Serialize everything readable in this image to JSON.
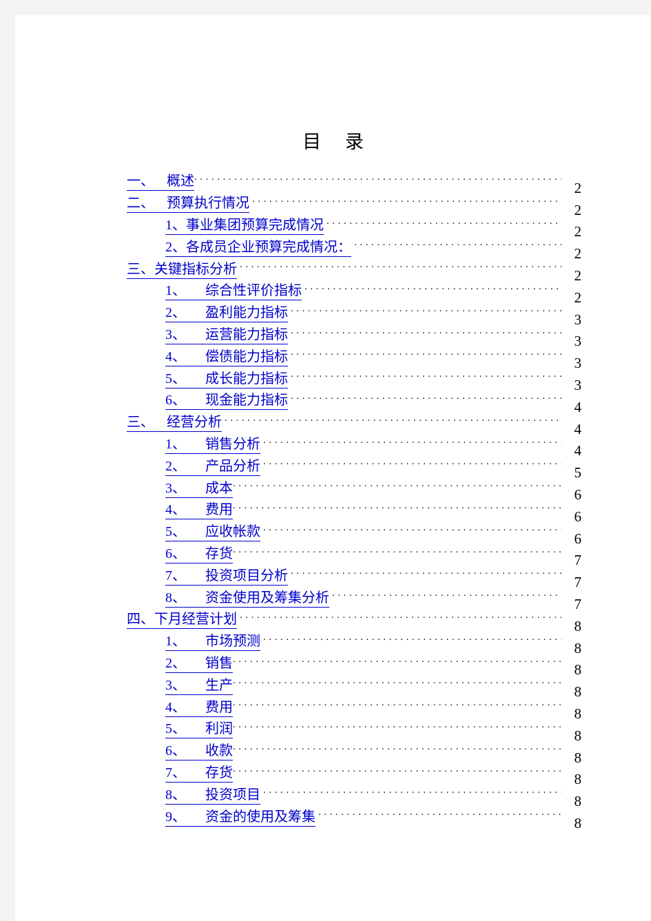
{
  "document": {
    "title": "目  录",
    "link_color": "#0000cc",
    "page_number_color": "#000000"
  },
  "toc": {
    "entries": [
      {
        "number": "一、",
        "label": "概述",
        "page": "2",
        "level": 1,
        "gap": "wide",
        "tight_leader": true
      },
      {
        "number": "二、",
        "label": "预算执行情况",
        "page": "2",
        "level": 1,
        "gap": "wide",
        "tight_leader": false
      },
      {
        "number": "1、",
        "label": "事业集团预算完成情况",
        "page": "2",
        "level": 2,
        "gap": "narrow",
        "tight_leader": false
      },
      {
        "number": "2、",
        "label": "各成员企业预算完成情况：",
        "page": "2",
        "level": 2,
        "gap": "narrow",
        "tight_leader": false
      },
      {
        "number": "三、",
        "label": "关键指标分析",
        "page": "2",
        "level": 1,
        "gap": "narrow",
        "tight_leader": false
      },
      {
        "number": "1、",
        "label": "综合性评价指标",
        "page": "2",
        "level": 2,
        "gap": "wide",
        "tight_leader": false
      },
      {
        "number": "2、",
        "label": "盈利能力指标",
        "page": "3",
        "level": 2,
        "gap": "wide",
        "tight_leader": false
      },
      {
        "number": "3、",
        "label": "运营能力指标",
        "page": "3",
        "level": 2,
        "gap": "wide",
        "tight_leader": false
      },
      {
        "number": "4、",
        "label": "偿债能力指标",
        "page": "3",
        "level": 2,
        "gap": "wide",
        "tight_leader": false
      },
      {
        "number": "5、",
        "label": "成长能力指标",
        "page": "3",
        "level": 2,
        "gap": "wide",
        "tight_leader": false
      },
      {
        "number": "6、",
        "label": "现金能力指标",
        "page": "4",
        "level": 2,
        "gap": "wide",
        "tight_leader": false
      },
      {
        "number": "三、",
        "label": "经营分析",
        "page": "4",
        "level": 1,
        "gap": "wide",
        "tight_leader": false
      },
      {
        "number": "1、",
        "label": "销售分析",
        "page": "4",
        "level": 2,
        "gap": "wide",
        "tight_leader": false
      },
      {
        "number": "2、",
        "label": "产品分析",
        "page": "5",
        "level": 2,
        "gap": "wide",
        "tight_leader": false
      },
      {
        "number": "3、",
        "label": "成本",
        "page": "6",
        "level": 2,
        "gap": "wide",
        "tight_leader": true
      },
      {
        "number": "4、",
        "label": "费用",
        "page": "6",
        "level": 2,
        "gap": "wide",
        "tight_leader": true
      },
      {
        "number": "5、",
        "label": "应收帐款",
        "page": "6",
        "level": 2,
        "gap": "wide",
        "tight_leader": false
      },
      {
        "number": "6、",
        "label": "存货",
        "page": "7",
        "level": 2,
        "gap": "wide",
        "tight_leader": true
      },
      {
        "number": "7、",
        "label": "投资项目分析",
        "page": "7",
        "level": 2,
        "gap": "wide",
        "tight_leader": false
      },
      {
        "number": "8、",
        "label": "资金使用及筹集分析",
        "page": "7",
        "level": 2,
        "gap": "wide",
        "tight_leader": false
      },
      {
        "number": "四、",
        "label": "下月经营计划",
        "page": "8",
        "level": 1,
        "gap": "narrow",
        "tight_leader": false
      },
      {
        "number": "1、",
        "label": "市场预测",
        "page": "8",
        "level": 2,
        "gap": "wide",
        "tight_leader": false
      },
      {
        "number": "2、",
        "label": "销售",
        "page": "8",
        "level": 2,
        "gap": "wide",
        "tight_leader": true
      },
      {
        "number": "3、",
        "label": "生产",
        "page": "8",
        "level": 2,
        "gap": "wide",
        "tight_leader": true
      },
      {
        "number": "4、",
        "label": "费用",
        "page": "8",
        "level": 2,
        "gap": "wide",
        "tight_leader": true
      },
      {
        "number": "5、",
        "label": "利润",
        "page": "8",
        "level": 2,
        "gap": "wide",
        "tight_leader": true
      },
      {
        "number": "6、",
        "label": "收款",
        "page": "8",
        "level": 2,
        "gap": "wide",
        "tight_leader": true
      },
      {
        "number": "7、",
        "label": "存货",
        "page": "8",
        "level": 2,
        "gap": "wide",
        "tight_leader": true
      },
      {
        "number": "8、",
        "label": "投资项目",
        "page": "8",
        "level": 2,
        "gap": "wide",
        "tight_leader": false
      },
      {
        "number": "9、",
        "label": "资金的使用及筹集",
        "page": "8",
        "level": 2,
        "gap": "wide",
        "tight_leader": false
      }
    ]
  }
}
